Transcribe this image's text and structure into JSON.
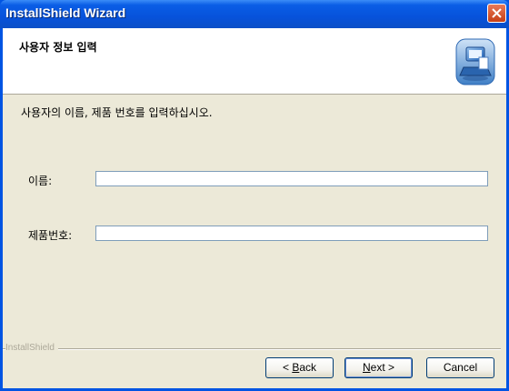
{
  "window": {
    "title": "InstallShield Wizard",
    "close_icon": "close-icon"
  },
  "header": {
    "title": "사용자 정보 입력",
    "icon": "installer-computer-icon"
  },
  "instruction": "사용자의 이름, 제품 번호를 입력하십시오.",
  "fields": {
    "name": {
      "label": "이름:",
      "value": ""
    },
    "serial": {
      "label": "제품번호:",
      "value": ""
    }
  },
  "brand": "InstallShield",
  "buttons": {
    "back": {
      "mnemonic": "B",
      "rest": "ack",
      "prefix": "< "
    },
    "next": {
      "mnemonic": "N",
      "rest": "ext >"
    },
    "cancel": {
      "label": "Cancel"
    }
  }
}
